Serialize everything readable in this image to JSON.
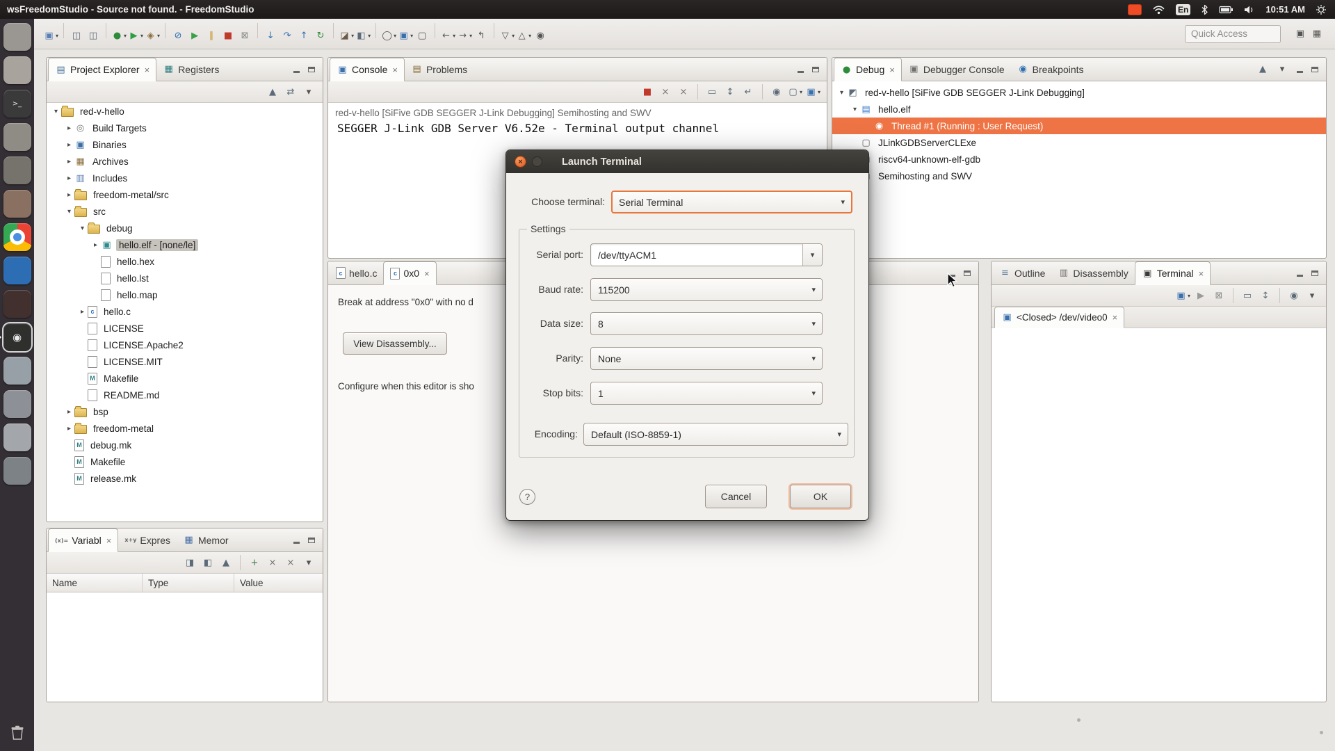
{
  "ubuntu_bar": {
    "title": "wsFreedomStudio - Source not found. - FreedomStudio",
    "keyboard_layout": "En",
    "time": "10:51 AM"
  },
  "launcher": {
    "icons": [
      {
        "name": "dash",
        "color": "#9a9792"
      },
      {
        "name": "files",
        "color": "#a8a39c"
      },
      {
        "name": "terminal",
        "color": "#3a3a3a"
      },
      {
        "name": "text-editor",
        "color": "#8f8b85"
      },
      {
        "name": "calculator",
        "color": "#76726c"
      },
      {
        "name": "software-center",
        "color": "#8a7060"
      },
      {
        "name": "chrome",
        "color": "#ffffff"
      },
      {
        "name": "media-app",
        "color": "#2d6db4"
      },
      {
        "name": "dark-app",
        "color": "#41302e"
      },
      {
        "name": "freedomstudio",
        "color": "#2f2f2e",
        "active": true
      },
      {
        "name": "app-1",
        "color": "#97a0a6"
      },
      {
        "name": "app-2",
        "color": "#8d9197"
      },
      {
        "name": "app-3",
        "color": "#a3a7ab"
      },
      {
        "name": "app-4",
        "color": "#7d8287"
      }
    ]
  },
  "main_toolbar": {
    "quick_access": "Quick Access",
    "groups": [
      [
        "new-wizard*"
      ],
      [
        "save",
        "save-all"
      ],
      [
        "debug*",
        "run*",
        "external-tools*"
      ],
      [
        "skip-breakpoints",
        "resume",
        "suspend",
        "terminate",
        "disconnect"
      ],
      [
        "step-into",
        "step-over",
        "step-return",
        "restart"
      ],
      [
        "build*",
        "new-file*"
      ],
      [
        "search*",
        "open-console*",
        "display-monitor"
      ],
      [
        "back*",
        "forward*",
        "last-edit-location"
      ],
      [
        "next-annotation*",
        "prev-annotation*",
        "pin-editor"
      ]
    ],
    "right_icons": [
      "open-perspective",
      "perspectives"
    ]
  },
  "project_explorer": {
    "tabs": [
      {
        "label": "Project Explorer",
        "icon": "project-explorer",
        "selected": true,
        "closable": true
      },
      {
        "label": "Registers",
        "icon": "registers"
      }
    ],
    "toolbar": [
      "collapse-all",
      "link-with-editor",
      "view-menu"
    ],
    "tree": [
      {
        "label": "red-v-hello",
        "level": 0,
        "state": "expanded",
        "icon": "project"
      },
      {
        "label": "Build Targets",
        "level": 1,
        "state": "collapsed",
        "icon": "build-targets"
      },
      {
        "label": "Binaries",
        "level": 1,
        "state": "collapsed",
        "icon": "binaries"
      },
      {
        "label": "Archives",
        "level": 1,
        "state": "collapsed",
        "icon": "archives"
      },
      {
        "label": "Includes",
        "level": 1,
        "state": "collapsed",
        "icon": "includes"
      },
      {
        "label": "freedom-metal/src",
        "level": 1,
        "state": "collapsed",
        "icon": "folder"
      },
      {
        "label": "src",
        "level": 1,
        "state": "expanded",
        "icon": "src-folder"
      },
      {
        "label": "debug",
        "level": 2,
        "state": "expanded",
        "icon": "folder"
      },
      {
        "label": "hello.elf - [none/le]",
        "level": 3,
        "state": "collapsed",
        "icon": "elf",
        "selected": true
      },
      {
        "label": "hello.hex",
        "level": 3,
        "state": "none",
        "icon": "file"
      },
      {
        "label": "hello.lst",
        "level": 3,
        "state": "none",
        "icon": "file"
      },
      {
        "label": "hello.map",
        "level": 3,
        "state": "none",
        "icon": "file"
      },
      {
        "label": "hello.c",
        "level": 2,
        "state": "collapsed",
        "icon": "c-file"
      },
      {
        "label": "LICENSE",
        "level": 2,
        "state": "none",
        "icon": "file"
      },
      {
        "label": "LICENSE.Apache2",
        "level": 2,
        "state": "none",
        "icon": "file"
      },
      {
        "label": "LICENSE.MIT",
        "level": 2,
        "state": "none",
        "icon": "file"
      },
      {
        "label": "Makefile",
        "level": 2,
        "state": "none",
        "icon": "makefile"
      },
      {
        "label": "README.md",
        "level": 2,
        "state": "none",
        "icon": "file"
      },
      {
        "label": "bsp",
        "level": 1,
        "state": "collapsed",
        "icon": "folder"
      },
      {
        "label": "freedom-metal",
        "level": 1,
        "state": "collapsed",
        "icon": "folder"
      },
      {
        "label": "debug.mk",
        "level": 1,
        "state": "none",
        "icon": "makefile"
      },
      {
        "label": "Makefile",
        "level": 1,
        "state": "none",
        "icon": "makefile"
      },
      {
        "label": "release.mk",
        "level": 1,
        "state": "none",
        "icon": "makefile"
      }
    ]
  },
  "console_panel": {
    "tabs": [
      {
        "label": "Console",
        "icon": "console",
        "selected": true,
        "closable": true
      },
      {
        "label": "Problems",
        "icon": "problems"
      }
    ],
    "toolbar": [
      "terminate",
      "remove-launch",
      "remove-all-terminated",
      "sep",
      "clear-console",
      "scroll-lock",
      "word-wrap",
      "sep",
      "pin-console",
      "display-selected-console*",
      "open-console*"
    ],
    "description": "red-v-hello [SiFive GDB SEGGER J-Link Debugging] Semihosting and SWV",
    "output": "SEGGER J-Link GDB Server V6.52e - Terminal output channel"
  },
  "editor": {
    "tabs": [
      {
        "label": "hello.c",
        "icon": "c-file"
      },
      {
        "label": "0x0",
        "icon": "c-file",
        "selected": true,
        "closable": true
      }
    ],
    "message_line1": "Break at address \"0x0\" with no d",
    "disassembly_button": "View Disassembly...",
    "message_line2": "Configure when this editor is sho"
  },
  "debug_panel": {
    "tabs": [
      {
        "label": "Debug",
        "icon": "debug",
        "selected": true,
        "closable": true
      },
      {
        "label": "Debugger Console",
        "icon": "debugger-console"
      },
      {
        "label": "Breakpoints",
        "icon": "breakpoints"
      }
    ],
    "toolbar": [
      "collapse-all",
      "view-menu"
    ],
    "tree": [
      {
        "label": "red-v-hello [SiFive GDB SEGGER J-Link Debugging]",
        "level": 0,
        "state": "expanded",
        "icon": "launch-config"
      },
      {
        "label": "hello.elf",
        "level": 1,
        "state": "expanded",
        "icon": "program"
      },
      {
        "label": "Thread #1 (Running : User Request)",
        "level": 2,
        "state": "none",
        "icon": "thread",
        "selected": true
      },
      {
        "label": "JLinkGDBServerCLExe",
        "level": 1,
        "state": "none",
        "icon": "process"
      },
      {
        "label": "riscv64-unknown-elf-gdb",
        "level": 1,
        "state": "none",
        "icon": "process"
      },
      {
        "label": "Semihosting and SWV",
        "level": 1,
        "state": "none",
        "icon": "process"
      }
    ]
  },
  "variables_panel": {
    "tabs": [
      {
        "label": "Variabl",
        "icon": "variables",
        "selected": true,
        "closable": true
      },
      {
        "label": "Expres",
        "icon": "expressions"
      },
      {
        "label": "Memor",
        "icon": "memory"
      }
    ],
    "toolbar": [
      "show-type-names",
      "show-logical-structure",
      "collapse-all",
      "sep",
      "new-watch-expression",
      "remove",
      "remove-all",
      "view-menu"
    ],
    "columns": [
      "Name",
      "Type",
      "Value"
    ]
  },
  "terminal_panel": {
    "tabs": [
      {
        "label": "Outline",
        "icon": "outline"
      },
      {
        "label": "Disassembly",
        "icon": "disassembly"
      },
      {
        "label": "Terminal",
        "icon": "terminal",
        "selected": true,
        "closable": true
      }
    ],
    "toolbar": [
      "new-terminal*",
      "connect",
      "disconnect",
      "sep",
      "clear-terminal",
      "scroll-lock",
      "sep",
      "pin-terminal",
      "terminal-view-menu"
    ],
    "inner_tab": {
      "label": "<Closed> /dev/video0",
      "icon": "serial-monitor",
      "closable": true
    }
  },
  "dialog": {
    "title": "Launch Terminal",
    "choose_label": "Choose terminal:",
    "choose_value": "Serial Terminal",
    "settings_label": "Settings",
    "fields": [
      {
        "label": "Serial port:",
        "value": "/dev/ttyACM1"
      },
      {
        "label": "Baud rate:",
        "value": "115200"
      },
      {
        "label": "Data size:",
        "value": "8"
      },
      {
        "label": "Parity:",
        "value": "None"
      },
      {
        "label": "Stop bits:",
        "value": "1"
      }
    ],
    "encoding_label": "Encoding:",
    "encoding_value": "Default (ISO-8859-1)",
    "help_label": "?",
    "cancel_label": "Cancel",
    "ok_label": "OK"
  }
}
